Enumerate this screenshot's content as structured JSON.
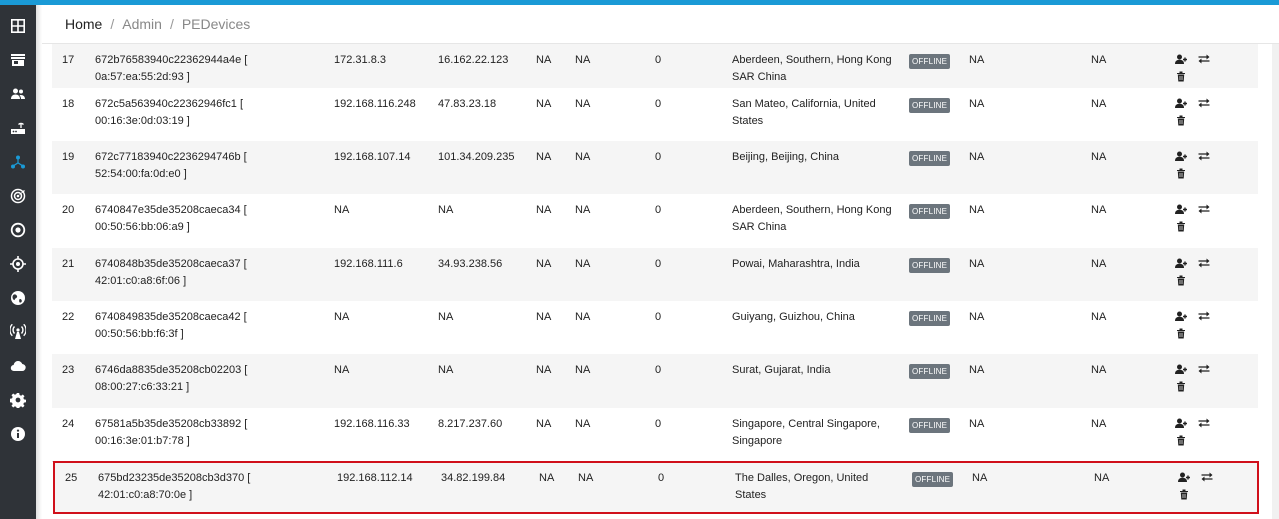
{
  "breadcrumb": {
    "home": "Home",
    "sep": "/",
    "admin": "Admin",
    "page": "PEDevices"
  },
  "sidebar": {
    "items": [
      {
        "icon": "dashboard-icon"
      },
      {
        "icon": "store-icon"
      },
      {
        "icon": "users-icon"
      },
      {
        "icon": "router-icon"
      },
      {
        "icon": "network-icon",
        "active": true
      },
      {
        "icon": "radar-icon"
      },
      {
        "icon": "target-icon"
      },
      {
        "icon": "crosshair-icon"
      },
      {
        "icon": "globe-icon"
      },
      {
        "icon": "antenna-icon"
      },
      {
        "icon": "cloud-icon"
      },
      {
        "icon": "gear-icon"
      },
      {
        "icon": "info-icon"
      }
    ]
  },
  "colors": {
    "accent": "#1a9ad6",
    "sidebar": "#2f3338",
    "badge": "#6c757d",
    "highlight": "#d0101b"
  },
  "rows": [
    {
      "idx": "17",
      "id": "672b76583940c22362944a4e [",
      "mac": "0a:57:ea:55:2d:93 ]",
      "ip_private": "172.31.8.3",
      "ip_public": "16.162.22.123",
      "col5": "NA",
      "col6": "NA",
      "count": "0",
      "location": [
        "Aberdeen, Southern, Hong Kong",
        "SAR China"
      ],
      "status": "OFFLINE",
      "col10": "NA",
      "col11": "NA"
    },
    {
      "idx": "18",
      "id": "672c5a563940c22362946fc1 [",
      "mac": "00:16:3e:0d:03:19 ]",
      "ip_private": "192.168.116.248",
      "ip_public": "47.83.23.18",
      "col5": "NA",
      "col6": "NA",
      "count": "0",
      "location": [
        "San Mateo, California, United",
        "States"
      ],
      "status": "OFFLINE",
      "col10": "NA",
      "col11": "NA"
    },
    {
      "idx": "19",
      "id": "672c77183940c2236294746b [",
      "mac": "52:54:00:fa:0d:e0 ]",
      "ip_private": "192.168.107.14",
      "ip_public": "101.34.209.235",
      "col5": "NA",
      "col6": "NA",
      "count": "0",
      "location": [
        "Beijing, Beijing, China",
        ""
      ],
      "status": "OFFLINE",
      "col10": "NA",
      "col11": "NA"
    },
    {
      "idx": "20",
      "id": "6740847e35de35208caeca34 [",
      "mac": "00:50:56:bb:06:a9 ]",
      "ip_private": "NA",
      "ip_public": "NA",
      "col5": "NA",
      "col6": "NA",
      "count": "0",
      "location": [
        "Aberdeen, Southern, Hong Kong",
        "SAR China"
      ],
      "status": "OFFLINE",
      "col10": "NA",
      "col11": "NA"
    },
    {
      "idx": "21",
      "id": "6740848b35de35208caeca37 [",
      "mac": "42:01:c0:a8:6f:06 ]",
      "ip_private": "192.168.111.6",
      "ip_public": "34.93.238.56",
      "col5": "NA",
      "col6": "NA",
      "count": "0",
      "location": [
        "Powai, Maharashtra, India",
        ""
      ],
      "status": "OFFLINE",
      "col10": "NA",
      "col11": "NA"
    },
    {
      "idx": "22",
      "id": "6740849835de35208caeca42 [",
      "mac": "00:50:56:bb:f6:3f ]",
      "ip_private": "NA",
      "ip_public": "NA",
      "col5": "NA",
      "col6": "NA",
      "count": "0",
      "location": [
        "Guiyang, Guizhou, China",
        ""
      ],
      "status": "OFFLINE",
      "col10": "NA",
      "col11": "NA"
    },
    {
      "idx": "23",
      "id": "6746da8835de35208cb02203 [",
      "mac": "08:00:27:c6:33:21 ]",
      "ip_private": "NA",
      "ip_public": "NA",
      "col5": "NA",
      "col6": "NA",
      "count": "0",
      "location": [
        "Surat, Gujarat, India",
        ""
      ],
      "status": "OFFLINE",
      "col10": "NA",
      "col11": "NA"
    },
    {
      "idx": "24",
      "id": "67581a5b35de35208cb33892 [",
      "mac": "00:16:3e:01:b7:78 ]",
      "ip_private": "192.168.116.33",
      "ip_public": "8.217.237.60",
      "col5": "NA",
      "col6": "NA",
      "count": "0",
      "location": [
        "Singapore, Central Singapore,",
        "Singapore"
      ],
      "status": "OFFLINE",
      "col10": "NA",
      "col11": "NA"
    },
    {
      "idx": "25",
      "id": "675bd23235de35208cb3d370 [",
      "mac": "42:01:c0:a8:70:0e ]",
      "ip_private": "192.168.112.14",
      "ip_public": "34.82.199.84",
      "col5": "NA",
      "col6": "NA",
      "count": "0",
      "location": [
        "The Dalles, Oregon, United",
        "States"
      ],
      "status": "OFFLINE",
      "col10": "NA",
      "col11": "NA",
      "highlighted": true
    }
  ]
}
